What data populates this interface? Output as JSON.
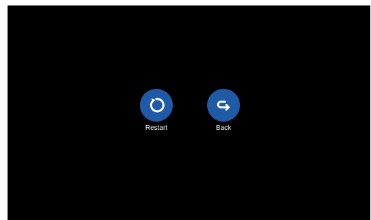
{
  "screen": {
    "background": "#000000",
    "accent": "#1f5aa6"
  },
  "actions": [
    {
      "label": "Restart",
      "icon": "restart-icon"
    },
    {
      "label": "Back",
      "icon": "back-arrow-icon"
    }
  ]
}
